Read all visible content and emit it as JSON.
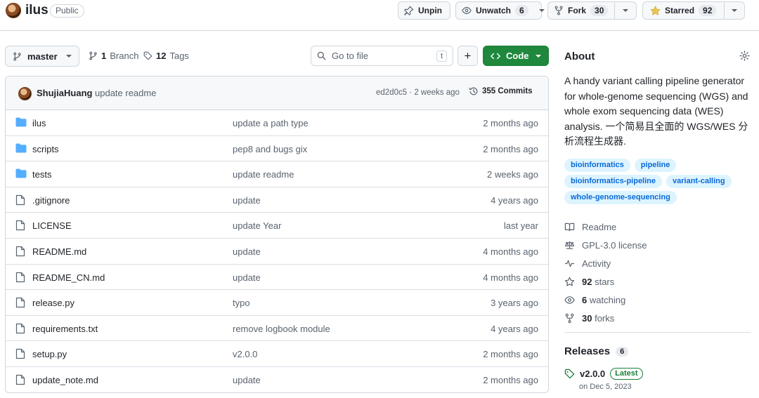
{
  "repo": {
    "name": "ilus",
    "visibility": "Public"
  },
  "header_actions": {
    "unpin": "Unpin",
    "watch": {
      "label": "Unwatch",
      "count": "6"
    },
    "fork": {
      "label": "Fork",
      "count": "30"
    },
    "star": {
      "label": "Starred",
      "count": "92"
    }
  },
  "toolbar": {
    "branch": "master",
    "branches": {
      "count": "1",
      "label": "Branch"
    },
    "tags": {
      "count": "12",
      "label": "Tags"
    },
    "search_placeholder": "Go to file",
    "search_kbd": "t",
    "add": "+",
    "code": "Code"
  },
  "commit": {
    "author": "ShujiaHuang",
    "message": "update readme",
    "meta": "ed2d0c5 · 2 weeks ago",
    "count": "355 Commits"
  },
  "files": [
    {
      "name": "ilus",
      "type": "dir",
      "message": "update a path type",
      "age": "2 months ago"
    },
    {
      "name": "scripts",
      "type": "dir",
      "message": "pep8 and bugs gix",
      "age": "2 months ago"
    },
    {
      "name": "tests",
      "type": "dir",
      "message": "update readme",
      "age": "2 weeks ago"
    },
    {
      "name": ".gitignore",
      "type": "file",
      "message": "update",
      "age": "4 years ago"
    },
    {
      "name": "LICENSE",
      "type": "file",
      "message": "update Year",
      "age": "last year"
    },
    {
      "name": "README.md",
      "type": "file",
      "message": "update",
      "age": "4 months ago"
    },
    {
      "name": "README_CN.md",
      "type": "file",
      "message": "update",
      "age": "4 months ago"
    },
    {
      "name": "release.py",
      "type": "file",
      "message": "typo",
      "age": "3 years ago"
    },
    {
      "name": "requirements.txt",
      "type": "file",
      "message": "remove logbook module",
      "age": "4 years ago"
    },
    {
      "name": "setup.py",
      "type": "file",
      "message": "v2.0.0",
      "age": "2 months ago"
    },
    {
      "name": "update_note.md",
      "type": "file",
      "message": "update",
      "age": "2 months ago"
    }
  ],
  "about": {
    "title": "About",
    "description": "A handy variant calling pipeline generator for whole-genome sequencing (WGS) and whole exom sequencing data (WES) analysis. 一个简易且全面的 WGS/WES 分析流程生成器.",
    "topics": [
      "bioinformatics",
      "pipeline",
      "bioinformatics-pipeline",
      "variant-calling",
      "whole-genome-sequencing"
    ],
    "readme": "Readme",
    "license": "GPL-3.0 license",
    "activity": "Activity",
    "stars": {
      "count": "92",
      "label": "stars"
    },
    "watching": {
      "count": "6",
      "label": "watching"
    },
    "forks": {
      "count": "30",
      "label": "forks"
    }
  },
  "releases": {
    "title": "Releases",
    "count": "6",
    "latest_version": "v2.0.0",
    "latest_badge": "Latest",
    "latest_date": "on Dec 5, 2023"
  },
  "colors": {
    "accent_green": "#1f883d",
    "link_blue": "#0969da",
    "folder_blue": "#54aeff",
    "star_yellow": "#eac54f"
  }
}
